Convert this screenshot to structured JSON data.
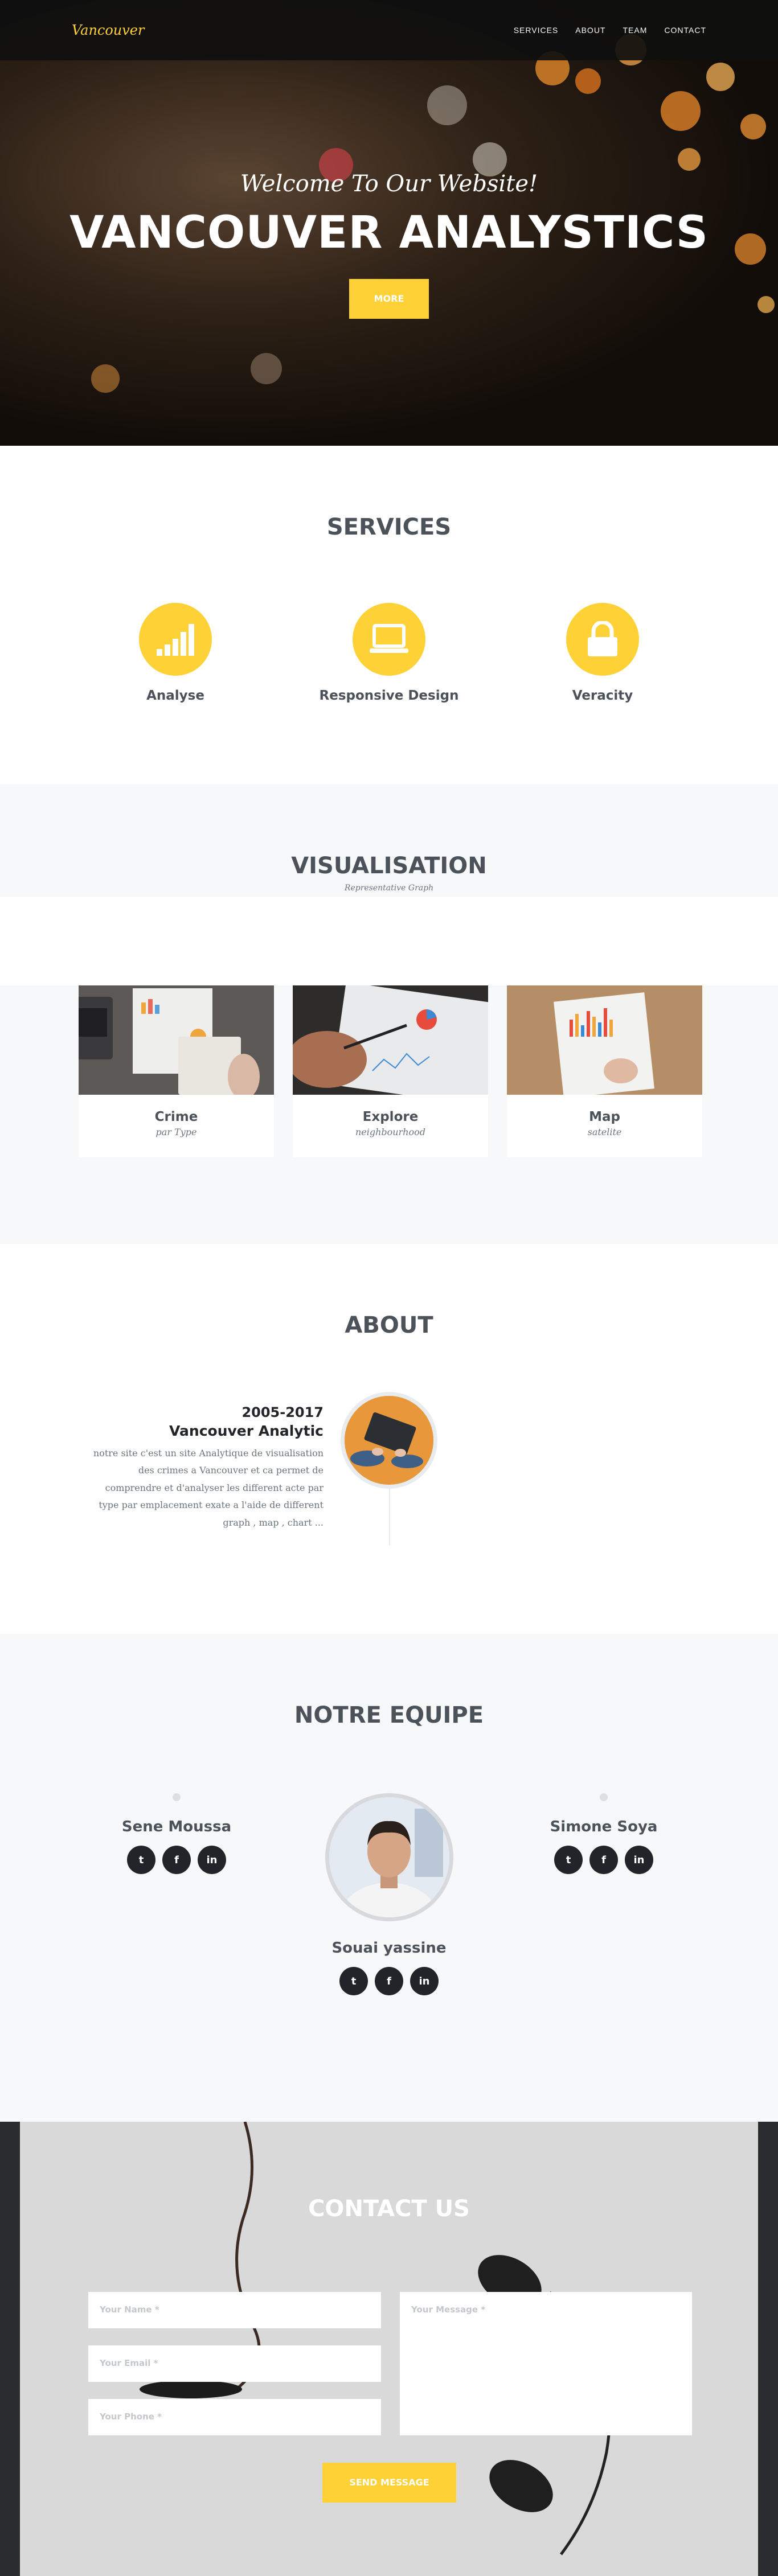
{
  "nav": {
    "brand": "Vancouver",
    "links": [
      "SERVICES",
      "ABOUT",
      "TEAM",
      "CONTACT"
    ]
  },
  "hero": {
    "subtitle": "Welcome To Our Website!",
    "title": "VANCOUVER ANALYSTICS",
    "button": "MORE"
  },
  "services": {
    "title": "SERVICES",
    "items": [
      {
        "label": "Analyse",
        "icon": "bar-chart-icon"
      },
      {
        "label": "Responsive Design",
        "icon": "laptop-icon"
      },
      {
        "label": "Veracity",
        "icon": "lock-icon"
      }
    ]
  },
  "visualisation": {
    "title": "VISUALISATION",
    "subtitle": "Representative Graph",
    "cards": [
      {
        "title": "Crime",
        "subtitle": "par Type"
      },
      {
        "title": "Explore",
        "subtitle": "neighbourhood"
      },
      {
        "title": "Map",
        "subtitle": "satelite"
      }
    ]
  },
  "about": {
    "title": "ABOUT",
    "year": "2005-2017",
    "name": "Vancouver Analytic",
    "text": "notre site c'est un site Analytique de visualisation des crimes a Vancouver et ca permet de comprendre et d'analyser les different acte par type par emplacement exate a l'aide de different graph , map , chart ..."
  },
  "team": {
    "title": "NOTRE EQUIPE",
    "members": [
      "Sene Moussa",
      "Souai yassine",
      "Simone Soya"
    ],
    "social_labels": [
      "t",
      "f",
      "in"
    ]
  },
  "contact": {
    "title": "CONTACT US",
    "name_placeholder": "Your Name *",
    "email_placeholder": "Your Email *",
    "phone_placeholder": "Your Phone *",
    "message_placeholder": "Your Message *",
    "button": "SEND MESSAGE"
  },
  "colors": {
    "accent": "#fed136",
    "heading": "#4b525a",
    "dark": "#212529"
  }
}
